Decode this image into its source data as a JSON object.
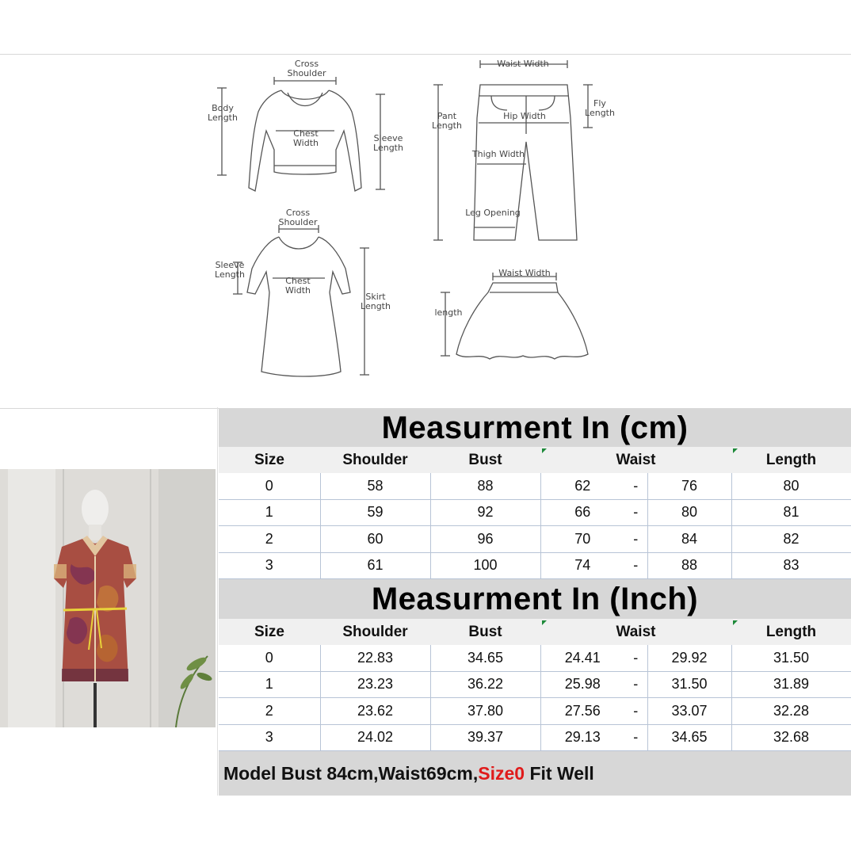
{
  "diagrams": {
    "top": {
      "cross_shoulder": "Cross\nShoulder",
      "body_length": "Body\nLength",
      "chest_width": "Chest\nWidth",
      "sleeve_length": "Sleeve\nLength"
    },
    "pants": {
      "waist_width": "Waist Width",
      "pant_length": "Pant\nLength",
      "hip_width": "Hip Width",
      "fly_length": "Fly\nLength",
      "thigh_width": "Thigh Width",
      "leg_opening": "Leg Opening"
    },
    "dress": {
      "cross_shoulder": "Cross\nShoulder",
      "sleeve_length": "Sleeve\nLength",
      "chest_width": "Chest\nWidth",
      "skirt_length": "Skirt\nLength"
    },
    "skirt": {
      "waist_width": "Waist Width",
      "length": "length"
    }
  },
  "cm_table": {
    "title": "Measurment In (cm)",
    "headers": {
      "size": "Size",
      "shoulder": "Shoulder",
      "bust": "Bust",
      "waist": "Waist",
      "length": "Length"
    },
    "rows": [
      {
        "size": "0",
        "shoulder": "58",
        "bust": "88",
        "waist_min": "62",
        "dash": "-",
        "waist_max": "76",
        "length": "80"
      },
      {
        "size": "1",
        "shoulder": "59",
        "bust": "92",
        "waist_min": "66",
        "dash": "-",
        "waist_max": "80",
        "length": "81"
      },
      {
        "size": "2",
        "shoulder": "60",
        "bust": "96",
        "waist_min": "70",
        "dash": "-",
        "waist_max": "84",
        "length": "82"
      },
      {
        "size": "3",
        "shoulder": "61",
        "bust": "100",
        "waist_min": "74",
        "dash": "-",
        "waist_max": "88",
        "length": "83"
      }
    ]
  },
  "inch_table": {
    "title": "Measurment In (Inch)",
    "headers": {
      "size": "Size",
      "shoulder": "Shoulder",
      "bust": "Bust",
      "waist": "Waist",
      "length": "Length"
    },
    "rows": [
      {
        "size": "0",
        "shoulder": "22.83",
        "bust": "34.65",
        "waist_min": "24.41",
        "dash": "-",
        "waist_max": "29.92",
        "length": "31.50"
      },
      {
        "size": "1",
        "shoulder": "23.23",
        "bust": "36.22",
        "waist_min": "25.98",
        "dash": "-",
        "waist_max": "31.50",
        "length": "31.89"
      },
      {
        "size": "2",
        "shoulder": "23.62",
        "bust": "37.80",
        "waist_min": "27.56",
        "dash": "-",
        "waist_max": "33.07",
        "length": "32.28"
      },
      {
        "size": "3",
        "shoulder": "24.02",
        "bust": "39.37",
        "waist_min": "29.13",
        "dash": "-",
        "waist_max": "34.65",
        "length": "32.68"
      }
    ]
  },
  "footer": {
    "text_before": "Model Bust 84cm,Waist69cm,",
    "highlight": "Size0",
    "text_after": " Fit Well",
    "highlight_color": "#e01b1b"
  }
}
